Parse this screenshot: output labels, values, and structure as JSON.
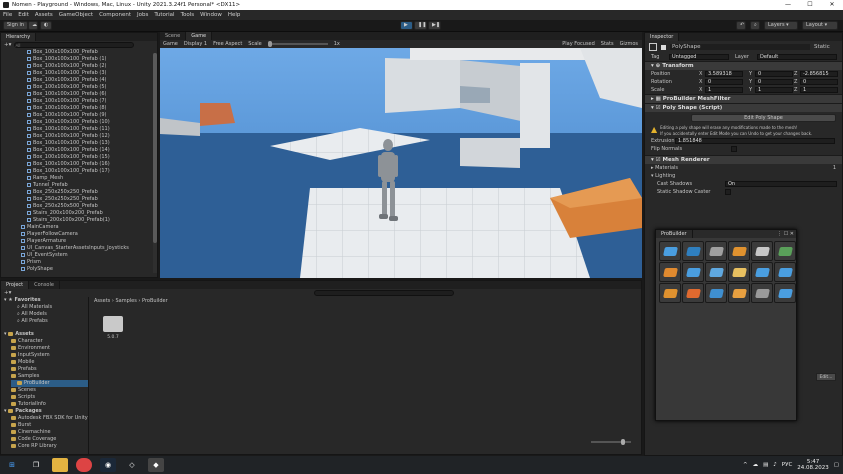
{
  "window": {
    "title": "Nomen - Playground - Windows, Mac, Linux - Unity 2021.3.24f1 Personal* <DX11>",
    "min": "—",
    "max": "☐",
    "close": "✕"
  },
  "menu": [
    "File",
    "Edit",
    "Assets",
    "GameObject",
    "Component",
    "Jobs",
    "Tutorial",
    "Tools",
    "Window",
    "Help"
  ],
  "toolbar": {
    "signin": "Sign in",
    "layers": "Layers",
    "layout": "Layout"
  },
  "hierarchy": {
    "tab": "Hierarchy",
    "search_placeholder": "All",
    "items": [
      "Box_100x100x100_Prefab",
      "Box_100x100x100_Prefab (1)",
      "Box_100x100x100_Prefab (2)",
      "Box_100x100x100_Prefab (3)",
      "Box_100x100x100_Prefab (4)",
      "Box_100x100x100_Prefab (5)",
      "Box_100x100x100_Prefab (6)",
      "Box_100x100x100_Prefab (7)",
      "Box_100x100x100_Prefab (8)",
      "Box_100x100x100_Prefab (9)",
      "Box_100x100x100_Prefab (10)",
      "Box_100x100x100_Prefab (11)",
      "Box_100x100x100_Prefab (12)",
      "Box_100x100x100_Prefab (13)",
      "Box_100x100x100_Prefab (14)",
      "Box_100x100x100_Prefab (15)",
      "Box_100x100x100_Prefab (16)",
      "Box_100x100x100_Prefab (17)",
      "Ramp_Mesh",
      "Tunnel_Prefab",
      "Box_250x250x250_Prefab",
      "Box_250x250x250_Prefab",
      "Box_250x250x500_Prefab",
      "Stairs_200x100x200_Prefab",
      "Stairs_200x100x200_Prefab(1)"
    ],
    "root_items": [
      "MainCamera",
      "PlayerFollowCamera",
      "PlayerArmature",
      "UI_Canvas_StarterAssetsInputs_Joysticks",
      "UI_EventSystem",
      "Prism",
      "PolyShape"
    ]
  },
  "scene_tabs": {
    "scene": "Scene",
    "game": "Game"
  },
  "game_bar": {
    "display": "Game",
    "display_num": "Display 1",
    "aspect": "Free Aspect",
    "scale_label": "Scale",
    "scale_value": "1x",
    "play_focused": "Play Focused",
    "stats": "Stats",
    "gizmos": "Gizmos"
  },
  "project": {
    "tab": "Project",
    "console": "Console",
    "favorites": "Favorites",
    "fav_items": [
      "All Materials",
      "All Models",
      "All Prefabs"
    ],
    "assets": "Assets",
    "asset_items": [
      "Character",
      "Environment",
      "InputSystem",
      "Mobile",
      "Prefabs",
      "Samples",
      "ProBuilder",
      "Scenes",
      "Scripts",
      "TutorialInfo"
    ],
    "packages": "Packages",
    "package_items": [
      "Autodesk FBX SDK for Unity",
      "Burst",
      "Cinemachine",
      "Code Coverage",
      "Core RP Library"
    ],
    "breadcrumb": [
      "Assets",
      "Samples",
      "ProBuilder"
    ],
    "folder_name": "5.0.7"
  },
  "inspector": {
    "tab": "Inspector",
    "object_name": "PolyShape",
    "static": "Static",
    "tag_label": "Tag",
    "tag_value": "Untagged",
    "layer_label": "Layer",
    "layer_value": "Default",
    "transform": "Transform",
    "position": {
      "label": "Position",
      "x": "3.589318",
      "y": "0",
      "z": "-2.856815"
    },
    "rotation": {
      "label": "Rotation",
      "x": "0",
      "y": "0",
      "z": "0"
    },
    "scale": {
      "label": "Scale",
      "x": "1",
      "y": "1",
      "z": "1"
    },
    "meshfilter": "ProBuilder MeshFilter",
    "polyshape": "Poly Shape (Script)",
    "edit_btn": "Edit Poly Shape",
    "warning1": "Editing a poly shape will erase any modifications made to the mesh!",
    "warning2": "If you accidentally enter Edit Mode you can Undo to get your changes back.",
    "extrusion_label": "Extrusion",
    "extrusion_value": "1.851848",
    "flip_label": "Flip Normals",
    "meshrenderer": "Mesh Renderer",
    "materials": "Materials",
    "materials_count": "1",
    "lighting": "Lighting",
    "cast_label": "Cast Shadows",
    "cast_value": "On",
    "static_shadow": "Static Shadow Caster",
    "edit_small": "Edit..."
  },
  "probuilder": {
    "title": "ProBuilder"
  },
  "taskbar": {
    "time": "5:47",
    "date": "24.08.2023",
    "lang": "РУС"
  },
  "colors": {
    "accent": "#2c5d87",
    "orange": "#d88a3c",
    "sky": "#4c8fd6"
  }
}
